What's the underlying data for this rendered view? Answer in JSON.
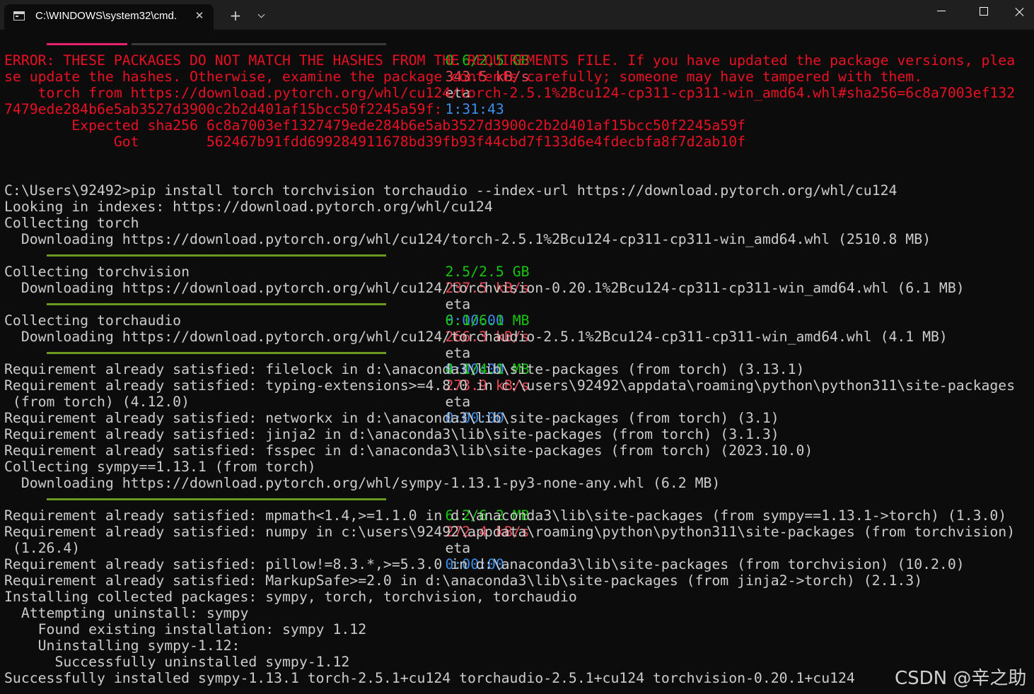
{
  "window": {
    "tab_title": "C:\\WINDOWS\\system32\\cmd.",
    "tab_icon": "console-icon",
    "new_tab_label": "+",
    "close_tab_icon": "close-icon",
    "dropdown_icon": "chevron-down-icon"
  },
  "colors": {
    "background": "#0c0c0c",
    "text": "#cccccc",
    "error": "#e81123",
    "progress_green": "#16c60c",
    "speed_red": "#e74856",
    "eta_blue": "#3b8eea",
    "bar_done": "#6a9a1f",
    "bar_active": "#e8216e"
  },
  "terminal": {
    "top_progress": {
      "progress": 0.24,
      "size": "0.6/2.5 GB",
      "speed": "343.5 kB/s",
      "eta_label": "eta",
      "eta": "1:31:43"
    },
    "error_lines": [
      "ERROR: THESE PACKAGES DO NOT MATCH THE HASHES FROM THE REQUIREMENTS FILE. If you have updated the package versions, plea",
      "se update the hashes. Otherwise, examine the package contents carefully; someone may have tampered with them.",
      "    torch from https://download.pytorch.org/whl/cu124/torch-2.5.1%2Bcu124-cp311-cp311-win_amd64.whl#sha256=6c8a7003ef132",
      "7479ede284b6e5ab3527d3900c2b2d401af15bcc50f2245a59f:",
      "        Expected sha256 6c8a7003ef1327479ede284b6e5ab3527d3900c2b2d401af15bcc50f2245a59f",
      "             Got        562467b91fdd699284911678bd39fb93f44cbd7f133d6e4fdecbfa8f7d2ab10f"
    ],
    "command": "C:\\Users\\92492>pip install torch torchvision torchaudio --index-url https://download.pytorch.org/whl/cu124",
    "looking": "Looking in indexes: https://download.pytorch.org/whl/cu124",
    "collect_torch": "Collecting torch",
    "dl_torch": "  Downloading https://download.pytorch.org/whl/cu124/torch-2.5.1%2Bcu124-cp311-cp311-win_amd64.whl (2510.8 MB)",
    "progress_torch": {
      "progress": 1,
      "size": "2.5/2.5 GB",
      "speed": "237.5 kB/s",
      "eta_label": "eta",
      "eta": "0:00:00"
    },
    "collect_torchvision": "Collecting torchvision",
    "dl_torchvision": "  Downloading https://download.pytorch.org/whl/cu124/torchvision-0.20.1%2Bcu124-cp311-cp311-win_amd64.whl (6.1 MB)",
    "progress_torchvision": {
      "progress": 1,
      "size": "6.1/6.1 MB",
      "speed": "266.3 kB/s",
      "eta_label": "eta",
      "eta": "0:00:00"
    },
    "collect_torchaudio": "Collecting torchaudio",
    "dl_torchaudio": "  Downloading https://download.pytorch.org/whl/cu124/torchaudio-2.5.1%2Bcu124-cp311-cp311-win_amd64.whl (4.1 MB)",
    "progress_torchaudio": {
      "progress": 1,
      "size": "4.1/4.1 MB",
      "speed": "273.9 kB/s",
      "eta_label": "eta",
      "eta": "0:00:00"
    },
    "req_block1": [
      "Requirement already satisfied: filelock in d:\\anaconda3\\lib\\site-packages (from torch) (3.13.1)",
      "Requirement already satisfied: typing-extensions>=4.8.0 in c:\\users\\92492\\appdata\\roaming\\python\\python311\\site-packages",
      " (from torch) (4.12.0)",
      "Requirement already satisfied: networkx in d:\\anaconda3\\lib\\site-packages (from torch) (3.1)",
      "Requirement already satisfied: jinja2 in d:\\anaconda3\\lib\\site-packages (from torch) (3.1.3)",
      "Requirement already satisfied: fsspec in d:\\anaconda3\\lib\\site-packages (from torch) (2023.10.0)",
      "Collecting sympy==1.13.1 (from torch)",
      "  Downloading https://download.pytorch.org/whl/sympy-1.13.1-py3-none-any.whl (6.2 MB)"
    ],
    "progress_sympy": {
      "progress": 1,
      "size": "6.2/6.2 MB",
      "speed": "272.4 kB/s",
      "eta_label": "eta",
      "eta": "0:00:00"
    },
    "req_block2": [
      "Requirement already satisfied: mpmath<1.4,>=1.1.0 in d:\\anaconda3\\lib\\site-packages (from sympy==1.13.1->torch) (1.3.0)",
      "Requirement already satisfied: numpy in c:\\users\\92492\\appdata\\roaming\\python\\python311\\site-packages (from torchvision)",
      " (1.26.4)",
      "Requirement already satisfied: pillow!=8.3.*,>=5.3.0 in d:\\anaconda3\\lib\\site-packages (from torchvision) (10.2.0)",
      "Requirement already satisfied: MarkupSafe>=2.0 in d:\\anaconda3\\lib\\site-packages (from jinja2->torch) (2.1.3)",
      "Installing collected packages: sympy, torch, torchvision, torchaudio",
      "  Attempting uninstall: sympy",
      "    Found existing installation: sympy 1.12",
      "    Uninstalling sympy-1.12:",
      "      Successfully uninstalled sympy-1.12",
      "Successfully installed sympy-1.13.1 torch-2.5.1+cu124 torchaudio-2.5.1+cu124 torchvision-0.20.1+cu124"
    ]
  },
  "watermark": "CSDN @辛之助"
}
